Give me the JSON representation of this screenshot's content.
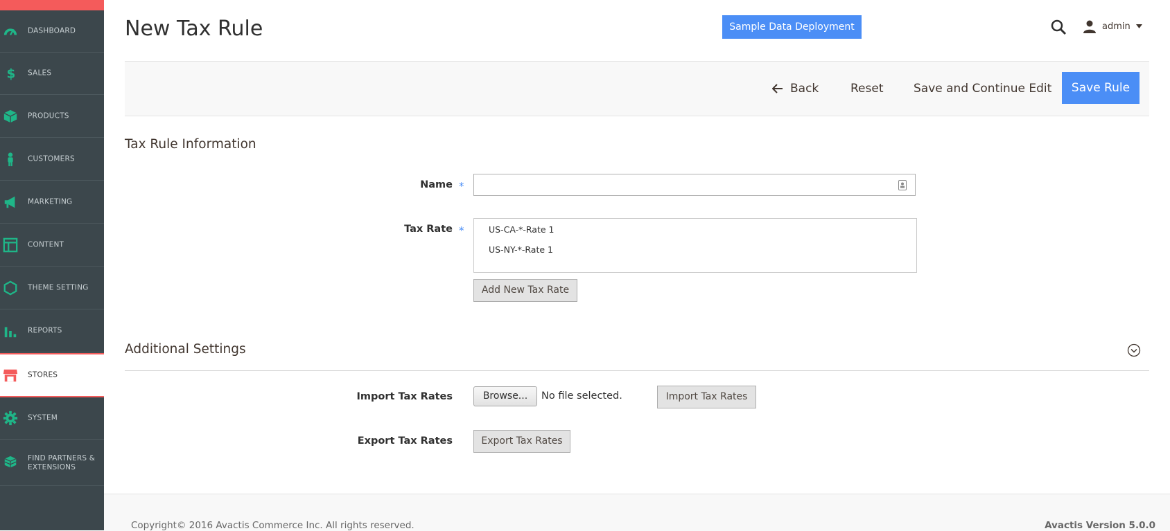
{
  "colors": {
    "sidebar_bg": "#3c474c",
    "accent_red": "#f45b5b",
    "icon_green": "#1fb688",
    "primary_blue": "#4b8ef6"
  },
  "sidebar": {
    "items": [
      {
        "label": "DASHBOARD",
        "icon": "dashboard-icon"
      },
      {
        "label": "SALES",
        "icon": "dollar-icon"
      },
      {
        "label": "PRODUCTS",
        "icon": "box-icon"
      },
      {
        "label": "CUSTOMERS",
        "icon": "person-icon"
      },
      {
        "label": "MARKETING",
        "icon": "megaphone-icon"
      },
      {
        "label": "CONTENT",
        "icon": "layout-icon"
      },
      {
        "label": "THEME SETTING",
        "icon": "hexagon-icon"
      },
      {
        "label": "REPORTS",
        "icon": "bar-chart-icon"
      },
      {
        "label": "STORES",
        "icon": "store-icon",
        "active": true
      },
      {
        "label": "SYSTEM",
        "icon": "gear-icon"
      },
      {
        "label": "FIND PARTNERS & EXTENSIONS",
        "icon": "cubes-icon"
      }
    ]
  },
  "header": {
    "title": "New Tax Rule",
    "sample_button": "Sample Data Deployment",
    "user": "admin"
  },
  "toolbar": {
    "back": "Back",
    "reset": "Reset",
    "save_continue": "Save and Continue Edit",
    "save_rule": "Save Rule"
  },
  "form": {
    "section_title": "Tax Rule Information",
    "name_label": "Name",
    "name_value": "",
    "required_mark": "*",
    "tax_rate_label": "Tax Rate",
    "tax_rates": [
      "US-CA-*-Rate 1",
      "US-NY-*-Rate 1"
    ],
    "add_rate_button": "Add New Tax Rate"
  },
  "additional": {
    "section_title": "Additional Settings",
    "import_label": "Import Tax Rates",
    "browse_button": "Browse...",
    "no_file": "No file selected.",
    "import_button": "Import Tax Rates",
    "export_label": "Export Tax Rates",
    "export_button": "Export Tax Rates"
  },
  "footer": {
    "copyright": "Copyright© 2016 Avactis Commerce Inc. All rights reserved.",
    "version": "Avactis Version 5.0.0"
  }
}
